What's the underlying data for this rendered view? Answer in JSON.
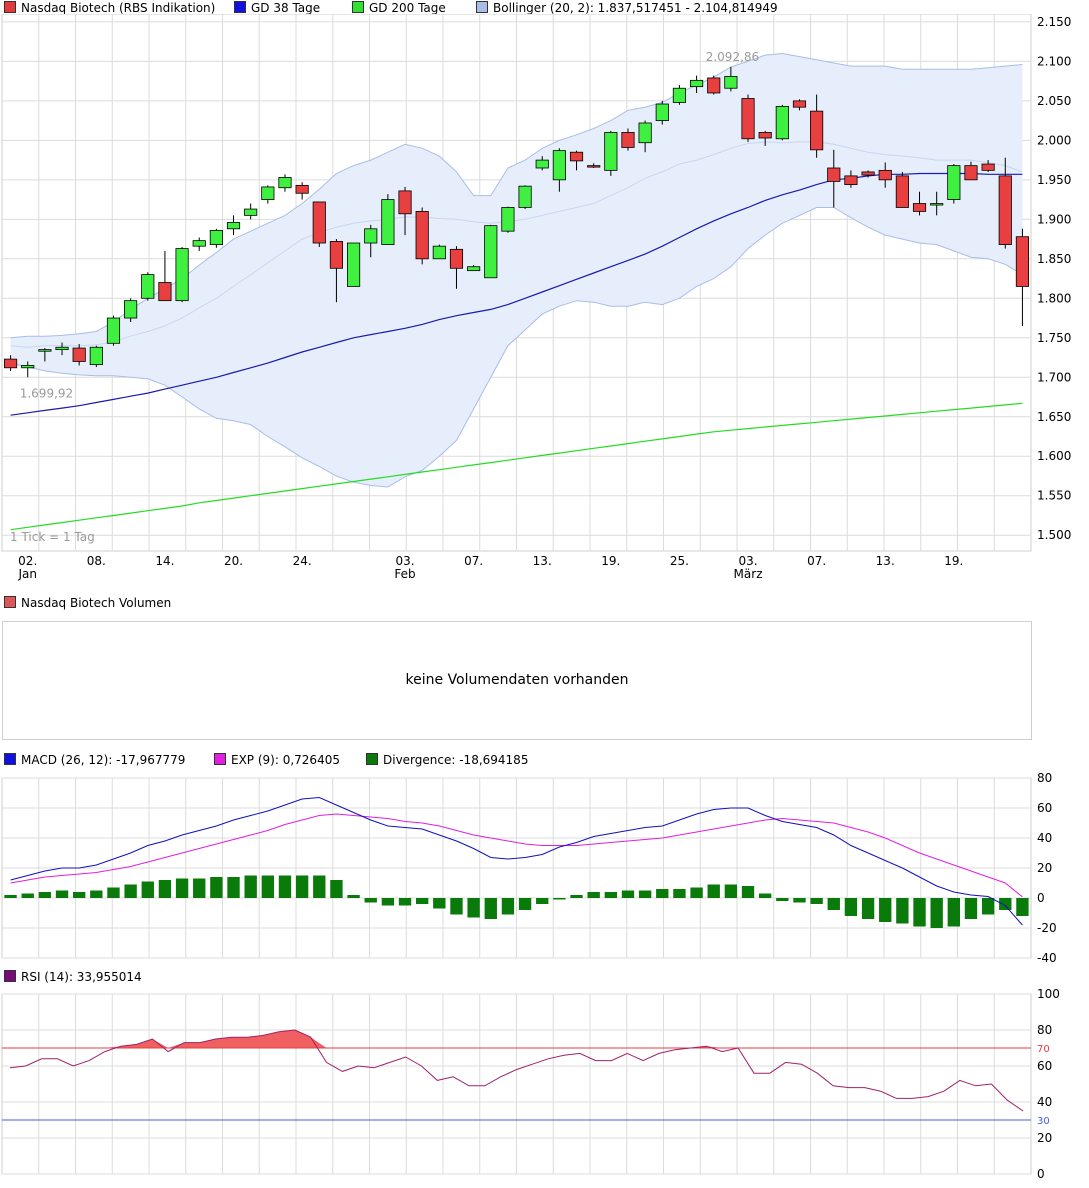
{
  "legends": {
    "price": [
      {
        "label": "Nasdaq Biotech (RBS Indikation)",
        "color": "#e33b3b"
      },
      {
        "label": "GD 38 Tage",
        "color": "#1010e0"
      },
      {
        "label": "GD 200 Tage",
        "color": "#33e033"
      },
      {
        "label": "Bollinger (20, 2): 1.837,517451 - 2.104,814949",
        "color": "#a9bde8"
      }
    ],
    "volume": [
      {
        "label": "Nasdaq Biotech Volumen",
        "color": "#e05555"
      }
    ],
    "macd": [
      {
        "label": "MACD (26, 12): -17,967779",
        "color": "#1010e0"
      },
      {
        "label": "EXP (9): 0,726405",
        "color": "#e020e0"
      },
      {
        "label": "Divergence: -18,694185",
        "color": "#0a7a0a"
      }
    ],
    "rsi": [
      {
        "label": "RSI (14): 33,955014",
        "color": "#7a0a7a"
      }
    ]
  },
  "volume_message": "keine Volumendaten vorhanden",
  "colors": {
    "up": "#40f040",
    "down": "#e84040",
    "sma38": "#1a1ab0",
    "sma200": "#22dd22",
    "band_fill": "#e6eefb",
    "band_line": "#a9bde8",
    "macd": "#1010c0",
    "signal": "#e020e0",
    "divergence": "#0a7a0a",
    "rsi": "#a0206a",
    "rsi_fill": "#f06060",
    "rsi70": "#e04040",
    "rsi30": "#4060e0",
    "grid": "#dcdcdc"
  },
  "chart_data": [
    {
      "type": "candlestick",
      "title": "Nasdaq Biotech (RBS Indikation)",
      "note": "1 Tick = 1 Tag",
      "x_tick_labels": [
        "02.",
        "08.",
        "14.",
        "20.",
        "24.",
        "03.",
        "07.",
        "13.",
        "19.",
        "25.",
        "03.",
        "07.",
        "13.",
        "19."
      ],
      "x_tick_index": [
        1,
        5,
        9,
        13,
        17,
        23,
        27,
        31,
        35,
        39,
        43,
        47,
        51,
        55
      ],
      "month_labels": [
        {
          "label": "Jan",
          "index": 1
        },
        {
          "label": "Feb",
          "index": 23
        },
        {
          "label": "März",
          "index": 43
        }
      ],
      "y_ticks": [
        1500,
        1550,
        1600,
        1650,
        1700,
        1750,
        1800,
        1850,
        1900,
        1950,
        2000,
        2050,
        2100,
        2150
      ],
      "y_tick_labels": [
        "1.500",
        "1.550",
        "1.600",
        "1.650",
        "1.700",
        "1.750",
        "1.800",
        "1.850",
        "1.900",
        "1.950",
        "2.000",
        "2.050",
        "2.100",
        "2.150"
      ],
      "ylim": [
        1480,
        2160
      ],
      "annotations": [
        {
          "text": "2.092,86",
          "index": 41,
          "value": 2092.86
        },
        {
          "text": "1.699,92",
          "index": 1,
          "value": 1699.92
        }
      ],
      "ohlc": [
        [
          1723,
          1728,
          1708,
          1712
        ],
        [
          1712,
          1720,
          1700,
          1715
        ],
        [
          1733,
          1737,
          1720,
          1735
        ],
        [
          1735,
          1744,
          1728,
          1738
        ],
        [
          1737,
          1742,
          1715,
          1720
        ],
        [
          1716,
          1740,
          1713,
          1738
        ],
        [
          1743,
          1778,
          1740,
          1775
        ],
        [
          1775,
          1800,
          1770,
          1797
        ],
        [
          1800,
          1833,
          1797,
          1830
        ],
        [
          1820,
          1860,
          1797,
          1797
        ],
        [
          1797,
          1865,
          1795,
          1863
        ],
        [
          1866,
          1877,
          1860,
          1873
        ],
        [
          1868,
          1888,
          1864,
          1886
        ],
        [
          1888,
          1905,
          1880,
          1896
        ],
        [
          1905,
          1920,
          1900,
          1913
        ],
        [
          1925,
          1943,
          1920,
          1941
        ],
        [
          1940,
          1957,
          1935,
          1953
        ],
        [
          1943,
          1947,
          1925,
          1933
        ],
        [
          1922,
          1922,
          1865,
          1870
        ],
        [
          1872,
          1875,
          1795,
          1838
        ],
        [
          1815,
          1870,
          1815,
          1870
        ],
        [
          1870,
          1893,
          1852,
          1888
        ],
        [
          1868,
          1932,
          1868,
          1925
        ],
        [
          1936,
          1941,
          1880,
          1907
        ],
        [
          1910,
          1915,
          1843,
          1850
        ],
        [
          1850,
          1868,
          1850,
          1866
        ],
        [
          1862,
          1866,
          1812,
          1838
        ],
        [
          1835,
          1842,
          1835,
          1840
        ],
        [
          1826,
          1893,
          1826,
          1892
        ],
        [
          1885,
          1916,
          1883,
          1915
        ],
        [
          1915,
          1943,
          1913,
          1942
        ],
        [
          1965,
          1980,
          1962,
          1975
        ],
        [
          1950,
          1990,
          1935,
          1987
        ],
        [
          1985,
          1987,
          1962,
          1974
        ],
        [
          1968,
          1971,
          1965,
          1967
        ],
        [
          1962,
          2012,
          1955,
          2010
        ],
        [
          2010,
          2015,
          1987,
          1991
        ],
        [
          1997,
          2025,
          1985,
          2022
        ],
        [
          2025,
          2050,
          2020,
          2046
        ],
        [
          2048,
          2070,
          2045,
          2066
        ],
        [
          2068,
          2082,
          2060,
          2076
        ],
        [
          2079,
          2082,
          2058,
          2060
        ],
        [
          2066,
          2093,
          2062,
          2081
        ],
        [
          2053,
          2058,
          1998,
          2002
        ],
        [
          2010,
          2012,
          1993,
          2003
        ],
        [
          2002,
          2045,
          2000,
          2043
        ],
        [
          2050,
          2052,
          2038,
          2042
        ],
        [
          2037,
          2058,
          1978,
          1988
        ],
        [
          1965,
          1988,
          1915,
          1948
        ],
        [
          1955,
          1962,
          1940,
          1944
        ],
        [
          1960,
          1962,
          1953,
          1956
        ],
        [
          1962,
          1972,
          1940,
          1950
        ],
        [
          1955,
          1960,
          1920,
          1915
        ],
        [
          1920,
          1935,
          1905,
          1910
        ],
        [
          1920,
          1935,
          1905,
          1920
        ],
        [
          1925,
          1970,
          1920,
          1968
        ],
        [
          1968,
          1973,
          1950,
          1950
        ],
        [
          1970,
          1975,
          1960,
          1962
        ],
        [
          1955,
          1978,
          1863,
          1868
        ],
        [
          1878,
          1888,
          1765,
          1815
        ]
      ],
      "sma38": [
        1652,
        1655,
        1658,
        1661,
        1664,
        1668,
        1672,
        1676,
        1680,
        1685,
        1690,
        1695,
        1700,
        1706,
        1712,
        1718,
        1725,
        1732,
        1738,
        1744,
        1750,
        1754,
        1758,
        1762,
        1767,
        1773,
        1778,
        1782,
        1786,
        1792,
        1800,
        1808,
        1816,
        1824,
        1832,
        1840,
        1848,
        1856,
        1866,
        1877,
        1888,
        1898,
        1907,
        1915,
        1924,
        1931,
        1937,
        1944,
        1950,
        1952,
        1955,
        1957,
        1957,
        1958,
        1958,
        1958,
        1958,
        1957,
        1957,
        1957
      ],
      "sma200": [
        1507,
        1510,
        1513,
        1516,
        1519,
        1522,
        1525,
        1528,
        1531,
        1534,
        1537,
        1541,
        1544,
        1547,
        1550,
        1553,
        1556,
        1559,
        1562,
        1565,
        1568,
        1571,
        1574,
        1577,
        1580,
        1583,
        1586,
        1589,
        1592,
        1595,
        1598,
        1601,
        1604,
        1607,
        1610,
        1613,
        1616,
        1619,
        1622,
        1625,
        1628,
        1631,
        1633,
        1635,
        1637,
        1639,
        1641,
        1643,
        1645,
        1647,
        1649,
        1651,
        1653,
        1655,
        1657,
        1659,
        1661,
        1663,
        1665,
        1667
      ],
      "bb_upper": [
        1750,
        1752,
        1752,
        1753,
        1755,
        1758,
        1770,
        1786,
        1800,
        1812,
        1825,
        1842,
        1858,
        1875,
        1885,
        1895,
        1905,
        1920,
        1938,
        1958,
        1968,
        1975,
        1985,
        1995,
        1990,
        1980,
        1960,
        1930,
        1930,
        1965,
        1975,
        1990,
        2000,
        2007,
        2015,
        2025,
        2038,
        2042,
        2048,
        2060,
        2070,
        2080,
        2093,
        2100,
        2108,
        2110,
        2106,
        2102,
        2098,
        2094,
        2094,
        2094,
        2090,
        2090,
        2090,
        2090,
        2090,
        2092,
        2094,
        2096
      ],
      "bb_mid": [
        1740,
        1738,
        1740,
        1740,
        1740,
        1741,
        1745,
        1752,
        1758,
        1765,
        1775,
        1788,
        1800,
        1815,
        1830,
        1845,
        1860,
        1875,
        1883,
        1890,
        1895,
        1898,
        1900,
        1903,
        1903,
        1901,
        1900,
        1897,
        1895,
        1897,
        1900,
        1905,
        1910,
        1915,
        1920,
        1930,
        1940,
        1952,
        1960,
        1970,
        1975,
        1982,
        1990,
        1996,
        1998,
        1997,
        1998,
        1998,
        1995,
        1990,
        1985,
        1982,
        1980,
        1978,
        1975,
        1975,
        1975,
        1972,
        1968,
        1960
      ],
      "bb_lower": [
        1718,
        1713,
        1708,
        1705,
        1703,
        1702,
        1702,
        1700,
        1698,
        1690,
        1675,
        1660,
        1648,
        1645,
        1640,
        1625,
        1612,
        1598,
        1587,
        1575,
        1567,
        1563,
        1561,
        1574,
        1582,
        1600,
        1620,
        1660,
        1700,
        1740,
        1760,
        1780,
        1790,
        1797,
        1795,
        1790,
        1790,
        1795,
        1792,
        1800,
        1815,
        1825,
        1840,
        1863,
        1880,
        1895,
        1905,
        1915,
        1915,
        1902,
        1890,
        1880,
        1875,
        1870,
        1868,
        1860,
        1852,
        1850,
        1843,
        1830
      ]
    },
    {
      "type": "bar+line",
      "title": "MACD (26, 12)",
      "y_ticks": [
        -40,
        -20,
        0,
        20,
        40,
        60,
        80
      ],
      "y_tick_labels": [
        "-40",
        "-20",
        "0",
        "20",
        "40",
        "60",
        "80"
      ],
      "ylim": [
        -40,
        80
      ],
      "series": [
        {
          "name": "MACD (26, 12)",
          "values": [
            12,
            15,
            18,
            20,
            20,
            22,
            26,
            30,
            35,
            38,
            42,
            45,
            48,
            52,
            55,
            58,
            62,
            66,
            67,
            62,
            57,
            52,
            48,
            47,
            46,
            42,
            38,
            33,
            27,
            26,
            27,
            29,
            34,
            37,
            41,
            43,
            45,
            47,
            48,
            52,
            56,
            59,
            60,
            60,
            55,
            51,
            49,
            47,
            42,
            35,
            30,
            25,
            20,
            14,
            8,
            4,
            2,
            1,
            -5,
            -18
          ]
        },
        {
          "name": "EXP (9)",
          "values": [
            10,
            12,
            14,
            15,
            16,
            17,
            19,
            21,
            24,
            27,
            30,
            33,
            36,
            39,
            42,
            45,
            49,
            52,
            55,
            56,
            55,
            54,
            53,
            51,
            50,
            48,
            45,
            42,
            40,
            38,
            36,
            35,
            35,
            35,
            36,
            37,
            38,
            39,
            40,
            42,
            44,
            46,
            48,
            50,
            52,
            53,
            52,
            51,
            50,
            47,
            44,
            40,
            35,
            30,
            26,
            22,
            18,
            14,
            10,
            0.7
          ]
        },
        {
          "name": "Divergence",
          "values": [
            2,
            3,
            4,
            5,
            4,
            5,
            7,
            9,
            11,
            12,
            13,
            13,
            14,
            14,
            15,
            15,
            15,
            15,
            15,
            12,
            2,
            -3,
            -5,
            -5,
            -4,
            -7,
            -11,
            -13,
            -14,
            -11,
            -8,
            -4,
            -1,
            2,
            4,
            4,
            5,
            5,
            6,
            6,
            7,
            9,
            9,
            8,
            3,
            -2,
            -3,
            -4,
            -8,
            -12,
            -14,
            -16,
            -17,
            -19,
            -20,
            -19,
            -14,
            -11,
            -8,
            -12,
            -19
          ]
        }
      ]
    },
    {
      "type": "line",
      "title": "RSI (14)",
      "y_ticks": [
        0,
        20,
        30,
        40,
        60,
        70,
        80,
        100
      ],
      "y_tick_labels": [
        "0",
        "20",
        "30",
        "40",
        "60",
        "70",
        "80",
        "100"
      ],
      "ylim": [
        0,
        100
      ],
      "series": [
        {
          "name": "RSI (14)",
          "values": [
            59,
            60,
            64,
            64,
            60,
            63,
            68,
            71,
            72,
            75,
            68,
            73,
            73,
            75,
            76,
            76,
            77,
            79,
            80,
            76,
            62,
            57,
            60,
            59,
            62,
            65,
            60,
            52,
            54,
            49,
            49,
            54,
            58,
            61,
            64,
            66,
            67,
            63,
            63,
            67,
            63,
            67,
            69,
            70,
            71,
            68,
            70,
            56,
            56,
            62,
            61,
            56,
            49,
            48,
            48,
            46,
            42,
            42,
            43,
            46,
            52,
            49,
            50,
            41,
            35
          ]
        }
      ],
      "levels": [
        {
          "value": 70,
          "label": "70"
        },
        {
          "value": 30,
          "label": "30"
        }
      ]
    }
  ]
}
